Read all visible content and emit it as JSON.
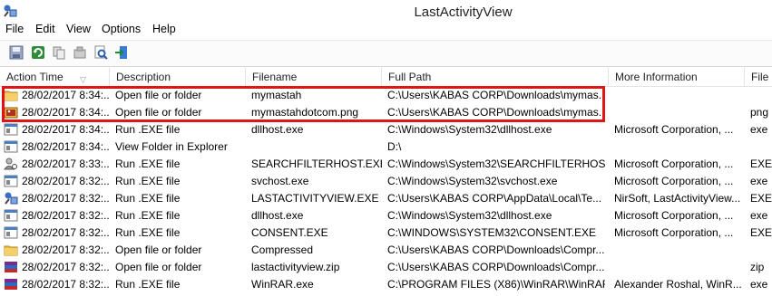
{
  "app": {
    "title": "LastActivityView"
  },
  "menu": [
    "File",
    "Edit",
    "View",
    "Options",
    "Help"
  ],
  "toolbar": [
    "save-icon",
    "refresh-icon",
    "copy-icon",
    "properties-icon",
    "find-icon",
    "exit-icon"
  ],
  "columns": [
    "Action Time",
    "Description",
    "Filename",
    "Full Path",
    "More Information",
    "File E"
  ],
  "rows": [
    {
      "icon": "folder-icon",
      "time": "28/02/2017 8:34:...",
      "desc": "Open file or folder",
      "file": "mymastah",
      "path": "C:\\Users\\KABAS CORP\\Downloads\\mymas...",
      "info": "",
      "ext": ""
    },
    {
      "icon": "image-file-icon",
      "time": "28/02/2017 8:34:...",
      "desc": "Open file or folder",
      "file": "mymastahdotcom.png",
      "path": "C:\\Users\\KABAS CORP\\Downloads\\mymas...",
      "info": "",
      "ext": "png"
    },
    {
      "icon": "exe-icon",
      "time": "28/02/2017 8:34:...",
      "desc": "Run .EXE file",
      "file": "dllhost.exe",
      "path": "C:\\Windows\\System32\\dllhost.exe",
      "info": "Microsoft Corporation, ...",
      "ext": "exe"
    },
    {
      "icon": "exe-icon",
      "time": "28/02/2017 8:34:...",
      "desc": "View Folder in Explorer",
      "file": "",
      "path": "D:\\",
      "info": "",
      "ext": ""
    },
    {
      "icon": "user-search-icon",
      "time": "28/02/2017 8:33:...",
      "desc": "Run .EXE file",
      "file": "SEARCHFILTERHOST.EXE",
      "path": "C:\\Windows\\System32\\SEARCHFILTERHOS...",
      "info": "Microsoft Corporation, ...",
      "ext": "EXE"
    },
    {
      "icon": "exe-icon",
      "time": "28/02/2017 8:32:...",
      "desc": "Run .EXE file",
      "file": "svchost.exe",
      "path": "C:\\Windows\\System32\\svchost.exe",
      "info": "Microsoft Corporation, ...",
      "ext": "exe"
    },
    {
      "icon": "lav-app-icon",
      "time": "28/02/2017 8:32:...",
      "desc": "Run .EXE file",
      "file": "LASTACTIVITYVIEW.EXE",
      "path": "C:\\Users\\KABAS CORP\\AppData\\Local\\Te...",
      "info": "NirSoft, LastActivityView...",
      "ext": "EXE"
    },
    {
      "icon": "exe-icon",
      "time": "28/02/2017 8:32:...",
      "desc": "Run .EXE file",
      "file": "dllhost.exe",
      "path": "C:\\Windows\\System32\\dllhost.exe",
      "info": "Microsoft Corporation, ...",
      "ext": "exe"
    },
    {
      "icon": "exe-icon",
      "time": "28/02/2017 8:32:...",
      "desc": "Run .EXE file",
      "file": "CONSENT.EXE",
      "path": "C:\\WINDOWS\\SYSTEM32\\CONSENT.EXE",
      "info": "Microsoft Corporation, ...",
      "ext": "EXE"
    },
    {
      "icon": "folder-icon",
      "time": "28/02/2017 8:32:...",
      "desc": "Open file or folder",
      "file": "Compressed",
      "path": "C:\\Users\\KABAS CORP\\Downloads\\Compr...",
      "info": "",
      "ext": ""
    },
    {
      "icon": "winrar-icon",
      "time": "28/02/2017 8:32:...",
      "desc": "Open file or folder",
      "file": "lastactivityview.zip",
      "path": "C:\\Users\\KABAS CORP\\Downloads\\Compr...",
      "info": "",
      "ext": "zip"
    },
    {
      "icon": "winrar-icon",
      "time": "28/02/2017 8:32:...",
      "desc": "Run .EXE file",
      "file": "WinRAR.exe",
      "path": "C:\\PROGRAM FILES (X86)\\WinRAR\\WinRAR...",
      "info": "Alexander Roshal, WinR...",
      "ext": "exe"
    }
  ]
}
